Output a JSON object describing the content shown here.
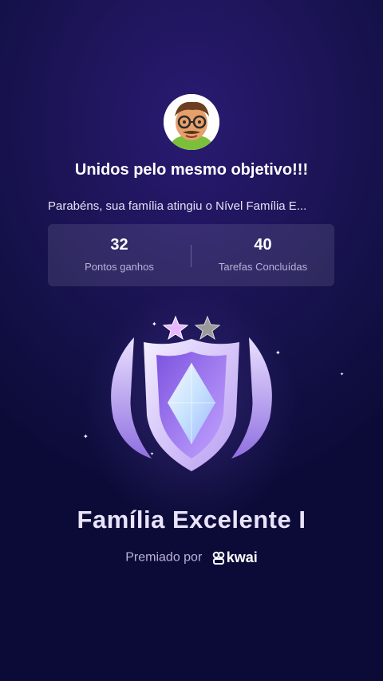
{
  "header": {
    "avatar_icon": "cartoon-man-avatar-icon",
    "title": "Unidos pelo mesmo objetivo!!!",
    "subtitle": "Parabéns, sua família atingiu o Nível Família E..."
  },
  "stats": [
    {
      "value": "32",
      "label": "Pontos ganhos"
    },
    {
      "value": "40",
      "label": "Tarefas Concluídas"
    }
  ],
  "badge": {
    "icon": "shield-crystal-badge-icon",
    "stars_filled": 1,
    "stars_total": 2
  },
  "level": {
    "name": "Família Excelente I"
  },
  "award": {
    "prefix": "Premiado por",
    "brand": "kwai"
  },
  "colors": {
    "background": "#1c1456",
    "accent": "#9d7ef0"
  }
}
